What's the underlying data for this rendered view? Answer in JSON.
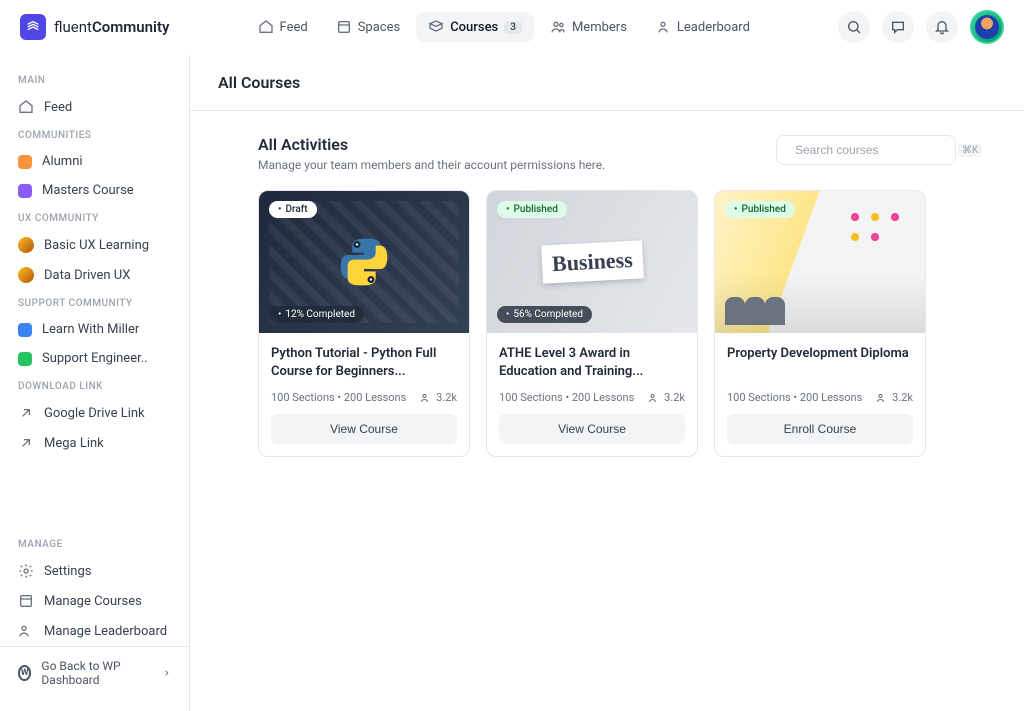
{
  "logo": {
    "brand1": "fluent",
    "brand2": "Community"
  },
  "nav": {
    "feed": "Feed",
    "spaces": "Spaces",
    "courses": "Courses",
    "courses_badge": "3",
    "members": "Members",
    "leaderboard": "Leaderboard"
  },
  "sidebar": {
    "main_label": "MAIN",
    "feed": "Feed",
    "communities_label": "COMMUNITIES",
    "alumni": "Alumni",
    "masters": "Masters Course",
    "ux_label": "UX COMMUNITY",
    "basic_ux": "Basic UX Learning",
    "data_ux": "Data Driven UX",
    "support_label": "SUPPORT COMMUNITY",
    "miller": "Learn With Miller",
    "engineer": "Support Engineer..",
    "download_label": "DOWNLOAD LINK",
    "gdrive": "Google Drive Link",
    "mega": "Mega Link",
    "manage_label": "MANAGE",
    "settings": "Settings",
    "manage_courses": "Manage Courses",
    "manage_leaderboard": "Manage Leaderboard",
    "wp_back": "Go Back to WP Dashboard"
  },
  "page": {
    "title": "All Courses",
    "subtitle": "All Activities",
    "desc": "Manage your team members and their account permissions here.",
    "search_placeholder": "Search courses",
    "search_kbd": "⌘K"
  },
  "cards": [
    {
      "status": "Draft",
      "status_type": "draft",
      "progress": "12% Completed",
      "title": "Python Tutorial - Python Full Course for Beginners...",
      "meta": "100 Sections • 200 Lessons",
      "users": "3.2k",
      "button": "View Course"
    },
    {
      "status": "Published",
      "status_type": "pub",
      "progress": "56% Completed",
      "title": "ATHE Level 3 Award in Education and Training...",
      "meta": "100 Sections • 200 Lessons",
      "users": "3.2k",
      "button": "View Course"
    },
    {
      "status": "Published",
      "status_type": "pub",
      "progress": "",
      "title": "Property Development Diploma",
      "meta": "100 Sections • 200 Lessons",
      "users": "3.2k",
      "button": "Enroll Course"
    }
  ]
}
